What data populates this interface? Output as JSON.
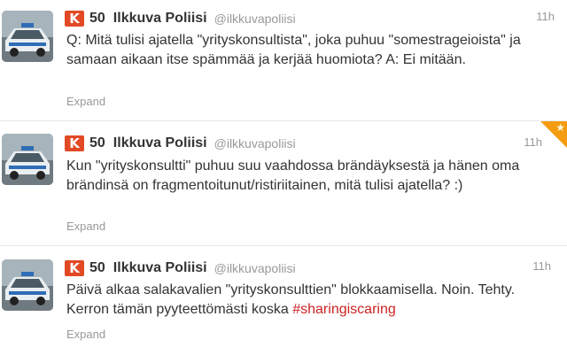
{
  "tweets": [
    {
      "klout_score": "50",
      "fullname": "Ilkkuva Poliisi",
      "username": "@ilkkuvapoliisi",
      "time": "11h",
      "text": "Q: Mitä tulisi ajatella \"yrityskonsultista\", joka puhuu \"somestrageioista\" ja samaan aikaan itse spämmää ja kerjää huomiota? A: Ei mitään.",
      "expand_label": "Expand",
      "favorited": false
    },
    {
      "klout_score": "50",
      "fullname": "Ilkkuva Poliisi",
      "username": "@ilkkuvapoliisi",
      "time": "11h",
      "text": "Kun \"yrityskonsultti\" puhuu suu vaahdossa brändäyksestä ja hänen oma brändinsä on fragmentoitunut/ristiriitainen, mitä tulisi ajatella? :)",
      "expand_label": "Expand",
      "favorited": true
    },
    {
      "klout_score": "50",
      "fullname": "Ilkkuva Poliisi",
      "username": "@ilkkuvapoliisi",
      "time": "11h",
      "text": "Päivä alkaa salakavalien \"yrityskonsulttien\" blokkaamisella. Noin. Tehty. Kerron tämän pyyteettömästi koska ",
      "hashtag": "#sharingiscaring",
      "expand_label": "Expand",
      "favorited": false
    }
  ],
  "icons": {
    "klout_glyph": "K",
    "favorite_star": "★"
  },
  "colors": {
    "klout": "#e24a25",
    "hashtag": "#cc2222",
    "favorite": "#f39c12",
    "muted": "#999999"
  }
}
